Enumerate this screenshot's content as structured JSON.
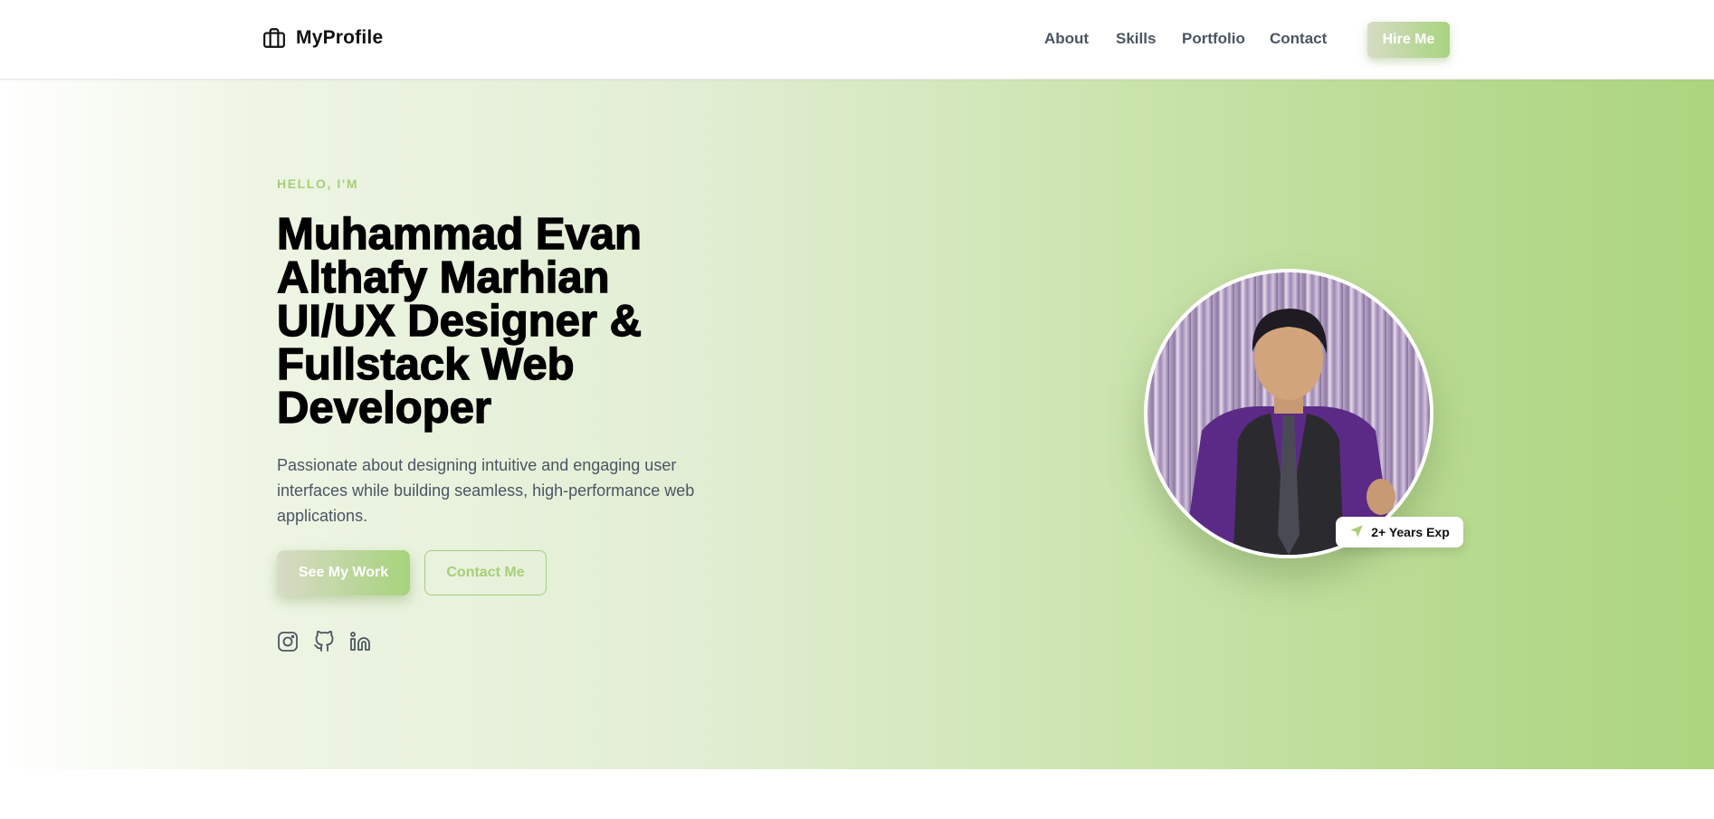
{
  "header": {
    "brand": "MyProfile",
    "brand_icon": "briefcase-icon",
    "nav": [
      {
        "label": "About"
      },
      {
        "label": "Skills"
      },
      {
        "label": "Portfolio"
      },
      {
        "label": "Contact"
      }
    ],
    "cta": "Hire Me"
  },
  "hero": {
    "eyebrow": "HELLO, I'M",
    "title_lines": [
      "Muhammad Evan",
      "Althafy Marhian",
      "UI/UX Designer &",
      "Fullstack Web",
      "Developer"
    ],
    "description": "Passionate about designing intuitive and engaging user interfaces while building seamless, high-performance web applications.",
    "primary_button": "See My Work",
    "secondary_button": "Contact Me",
    "socials": [
      "instagram-icon",
      "github-icon",
      "linkedin-icon"
    ],
    "badge": "2+ Years Exp",
    "badge_icon": "send-icon"
  },
  "colors": {
    "accent": "#a6cf78",
    "gradient_start": "#ffffff",
    "gradient_end": "#acd57f",
    "text_dark": "#000000",
    "text_muted": "#4b5563"
  }
}
